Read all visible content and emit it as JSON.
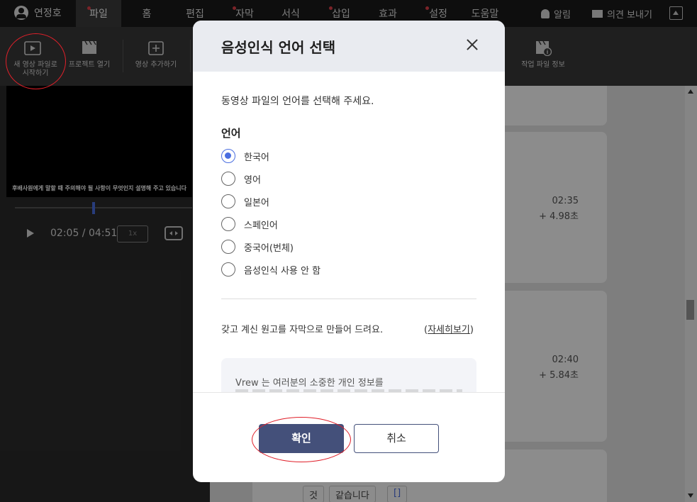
{
  "menubar": {
    "user_name": "연정호",
    "items": [
      {
        "label": "파일",
        "active": true,
        "dot": true
      },
      {
        "label": "홈",
        "active": false,
        "dot": false
      },
      {
        "label": "편집",
        "active": false,
        "dot": false
      },
      {
        "label": "자막",
        "active": false,
        "dot": true
      },
      {
        "label": "서식",
        "active": false,
        "dot": false
      },
      {
        "label": "삽입",
        "active": false,
        "dot": true
      },
      {
        "label": "효과",
        "active": false,
        "dot": false
      },
      {
        "label": "설정",
        "active": false,
        "dot": true
      },
      {
        "label": "도움말",
        "active": false,
        "dot": false
      }
    ],
    "alarm_label": "알림",
    "feedback_label": "의견 보내기"
  },
  "toolbar": {
    "new_video_label": "새 영상 파일로\n시작하기",
    "open_project_label": "프로젝트 열기",
    "add_video_label": "영상 추가하기",
    "project_info_label": "작업 파일 정보"
  },
  "player": {
    "subtitle": "후배사원에게 말할 때 주의해야 될 사항이 무엇인지 설명해 주고 있습니다",
    "time": "02:05 / 04:51",
    "speed": "1x",
    "progress": 0.43
  },
  "clips": [
    {
      "time": "02:35",
      "duration": "+ 4.98초"
    },
    {
      "time": "02:40",
      "duration": "+ 5.84초"
    }
  ],
  "words": [
    "것",
    "같습니다",
    "[]"
  ],
  "dialog": {
    "title": "음성인식 언어 선택",
    "description": "동영상 파일의 언어를 선택해 주세요.",
    "language_label": "언어",
    "options": [
      "한국어",
      "영어",
      "일본어",
      "스페인어",
      "중국어(번체)",
      "음성인식 사용 안 함"
    ],
    "selected": "한국어",
    "script_text": "갖고 계신 원고를 자막으로 만들어 드려요.",
    "detail_link": "자세히보기",
    "notice_text": "Vrew 는 여러분의 소중한 개인 정보를",
    "ok_label": "확인",
    "cancel_label": "취소"
  },
  "colors": {
    "accent": "#4a6ee0",
    "primary_button": "#44507a",
    "annotation": "#e0202a"
  }
}
